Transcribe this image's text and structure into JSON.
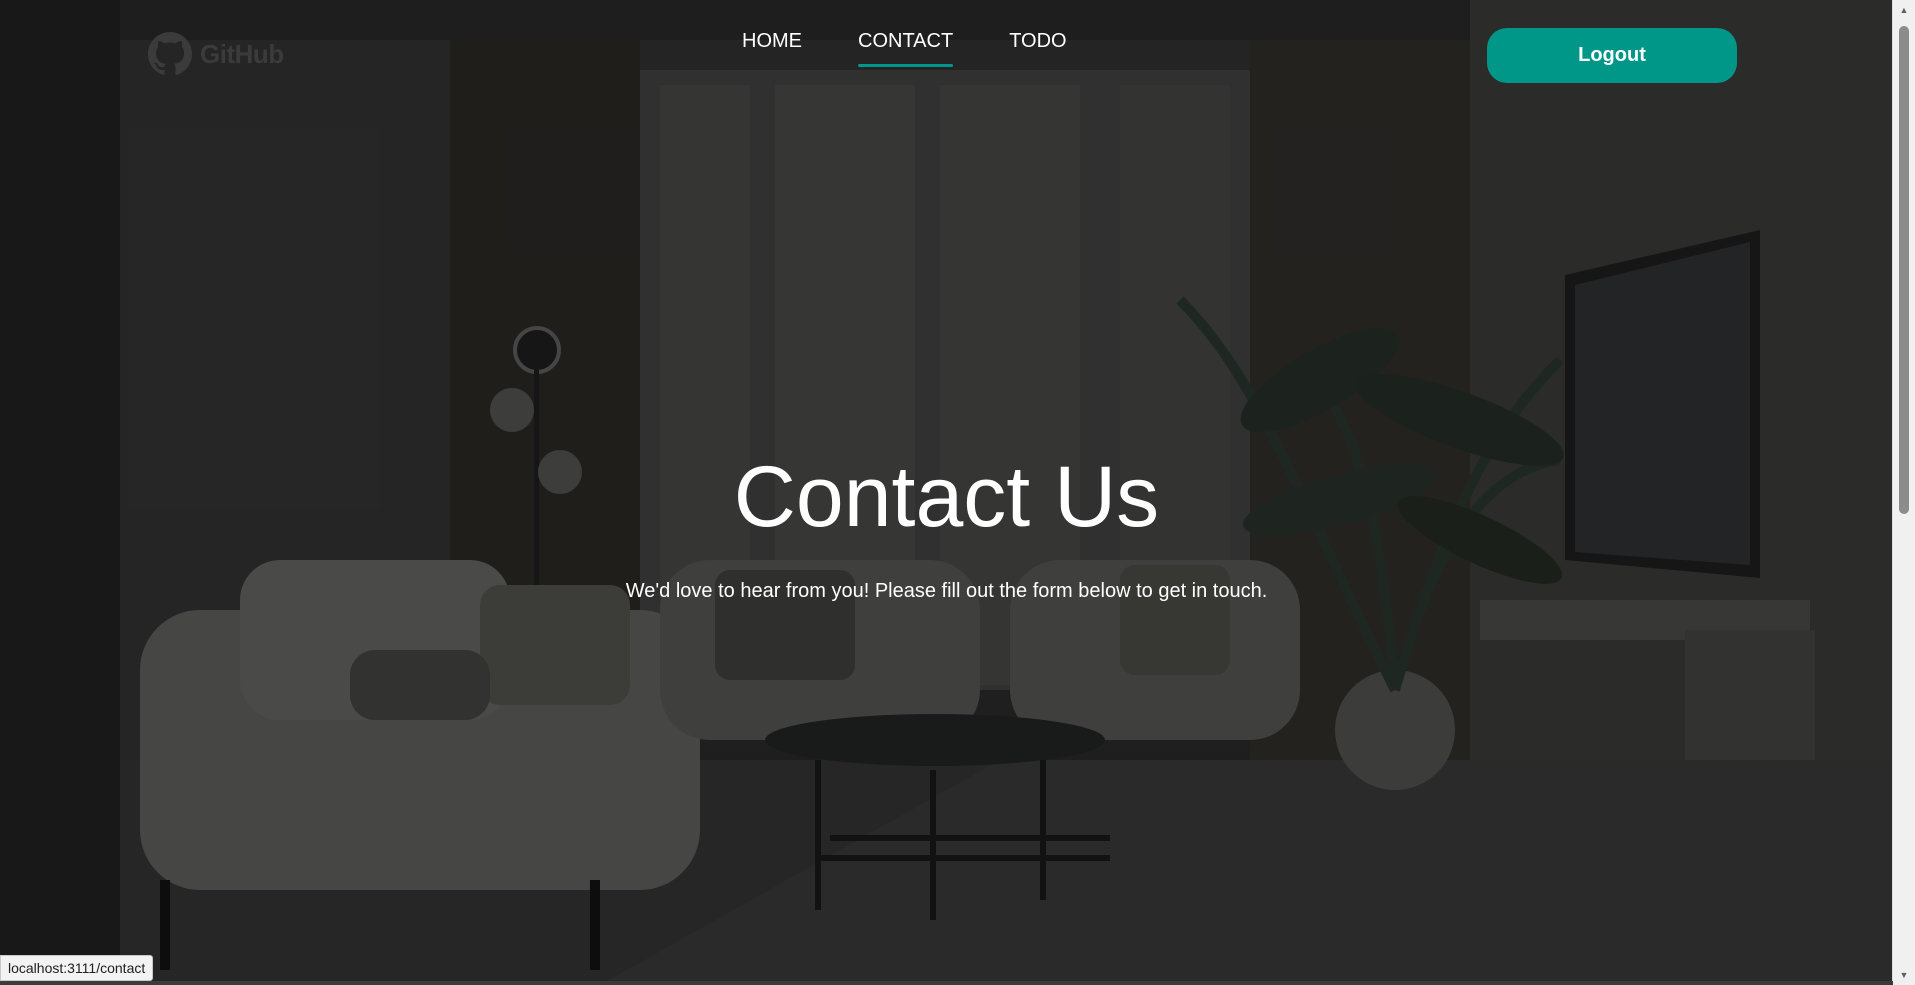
{
  "header": {
    "brand_label": "GitHub",
    "brand_icon": "github-icon",
    "nav": [
      {
        "label": "HOME",
        "active": false
      },
      {
        "label": "CONTACT",
        "active": true
      },
      {
        "label": "TODO",
        "active": false
      }
    ],
    "logout_label": "Logout"
  },
  "hero": {
    "title": "Contact Us",
    "subtitle": "We'd love to hear from you! Please fill out the form below to get in touch."
  },
  "status_bar": {
    "url": "localhost:3111/contact"
  },
  "colors": {
    "accent": "#009688",
    "text": "#ffffff",
    "background": "#2a2b2a"
  }
}
